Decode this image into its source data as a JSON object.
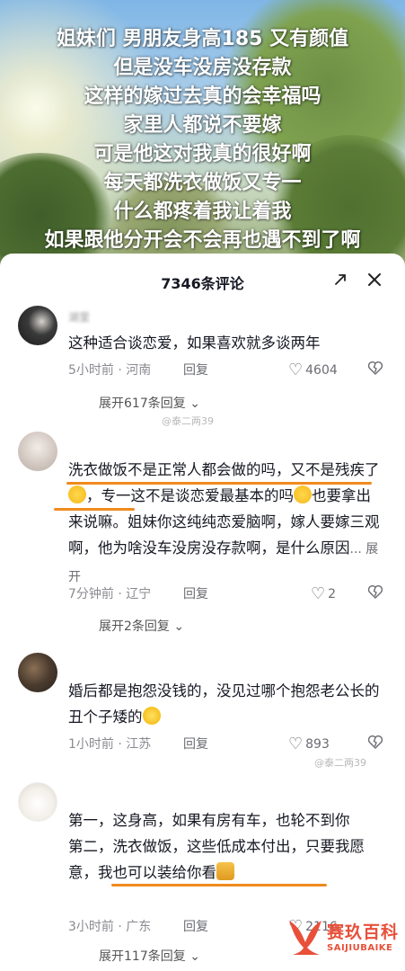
{
  "video": {
    "overlay_lines": [
      "姐妹们 男朋友身高185 又有颜值",
      "但是没车没房没存款",
      "这样的嫁过去真的会幸福吗",
      "家里人都说不要嫁",
      "可是他这对我真的很好啊",
      "每天都洗衣做饭又专一",
      "什么都疼着我让着我",
      "如果跟他分开会不会再也遇不到了啊"
    ]
  },
  "sheet": {
    "title": "7346条评论",
    "expand_icon": "expand-icon",
    "close_icon": "close-icon"
  },
  "comments": [
    {
      "username": "湖里",
      "text": "这种适合谈恋爱，如果喜欢就多谈两年",
      "time": "5小时前 · 河南",
      "reply": "回复",
      "likes": "4604",
      "expand": "展开617条回复"
    },
    {
      "username": "",
      "text_a": "洗衣做饭不是正常人都会做的吗，又不是",
      "text_b": "残疾了",
      "text_c": "，专一这不是谈恋爱最基本的吗",
      "text_d": "也要拿出来说嘛。姐妹你这纯纯恋爱脑啊，嫁人要嫁三观啊，他为啥没车没房没存款啊，是什么原因",
      "more": "... 展开",
      "time": "7分钟前 · 辽宁",
      "reply": "回复",
      "likes": "2",
      "expand": "展开2条回复"
    },
    {
      "username": "",
      "text": "婚后都是抱怨没钱的，没见过哪个抱怨老公长的丑个子矮的",
      "time": "1小时前 · 江苏",
      "reply": "回复",
      "likes": "893"
    },
    {
      "username": "",
      "text_a": "第一，这身高，如果有房有车，也轮不到你",
      "text_b": "第二，洗衣做饭，这些低成本付出，只要我愿意，我也可以装给你看",
      "time": "3小时前 · 广东",
      "reply": "回复",
      "likes": "2116",
      "expand": "展开117条回复"
    }
  ],
  "watermarks": [
    "@泰二两39",
    "@泰二两39"
  ],
  "brand": {
    "name": "赛玖百科",
    "sub": "SAIJIUBAIKE"
  },
  "colors": {
    "highlight": "#f08a1e",
    "brand": "#e8503a",
    "meta": "#8a8b91"
  }
}
